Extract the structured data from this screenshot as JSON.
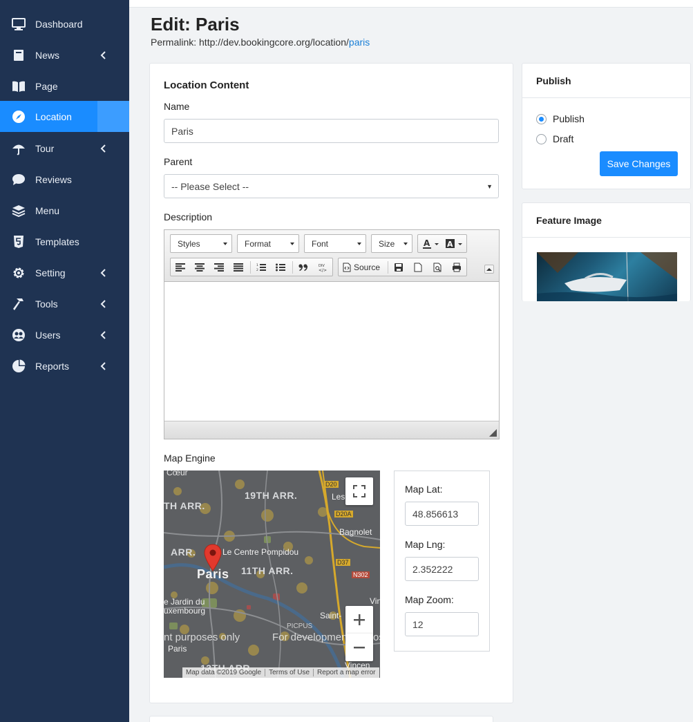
{
  "sidebar": {
    "items": [
      {
        "label": "Dashboard",
        "icon": "monitor-icon",
        "has_children": false,
        "active": false
      },
      {
        "label": "News",
        "icon": "book-icon",
        "has_children": true,
        "active": false
      },
      {
        "label": "Page",
        "icon": "book-open-icon",
        "has_children": false,
        "active": false
      },
      {
        "label": "Location",
        "icon": "compass-icon",
        "has_children": false,
        "active": true
      },
      {
        "label": "Tour",
        "icon": "umbrella-icon",
        "has_children": true,
        "active": false
      },
      {
        "label": "Reviews",
        "icon": "comment-icon",
        "has_children": false,
        "active": false
      },
      {
        "label": "Menu",
        "icon": "layers-icon",
        "has_children": false,
        "active": false
      },
      {
        "label": "Templates",
        "icon": "html5-icon",
        "has_children": false,
        "active": false
      },
      {
        "label": "Setting",
        "icon": "gear-icon",
        "has_children": true,
        "active": false
      },
      {
        "label": "Tools",
        "icon": "hammer-icon",
        "has_children": true,
        "active": false
      },
      {
        "label": "Users",
        "icon": "users-icon",
        "has_children": true,
        "active": false
      },
      {
        "label": "Reports",
        "icon": "pie-chart-icon",
        "has_children": true,
        "active": false
      }
    ]
  },
  "header": {
    "title": "Edit: Paris",
    "permalink_prefix": "Permalink: http://dev.bookingcore.org/location/",
    "permalink_slug": "paris"
  },
  "content": {
    "section_title": "Location Content",
    "name_label": "Name",
    "name_value": "Paris",
    "parent_label": "Parent",
    "parent_value": "-- Please Select --",
    "description_label": "Description",
    "editor": {
      "styles": "Styles",
      "format": "Format",
      "font": "Font",
      "size": "Size",
      "source": "Source"
    },
    "map_engine_label": "Map Engine"
  },
  "map": {
    "labels": {
      "coeur": "Cœur",
      "arr19": "19TH ARR.",
      "arr_th": "TH ARR.",
      "les": "Les",
      "bagnolet": "Bagnolet",
      "arr": "ARR.",
      "pompidou": "Le Centre Pompidou",
      "paris": "Paris",
      "arr11": "11TH ARR.",
      "jardin1": "e Jardin du",
      "jardin2": "uxembourg",
      "saint": "Saint-",
      "picpus": "PICPUS",
      "vin": "Vin",
      "paris_small": "Paris",
      "arr13": "13TH ARR",
      "vincen": "Vincen",
      "d20": "D20",
      "d20a": "D20A",
      "d37": "D37",
      "n302": "N302"
    },
    "watermark_left": "nt purposes only",
    "watermark_right": "For development",
    "watermark_right_tail": "os",
    "footer": [
      "Map data ©2019 Google",
      "Terms of Use",
      "Report a map error"
    ]
  },
  "coords": {
    "lat_label": "Map Lat:",
    "lat_value": "48.856613",
    "lng_label": "Map Lng:",
    "lng_value": "2.352222",
    "zoom_label": "Map Zoom:",
    "zoom_value": "12"
  },
  "publish": {
    "title": "Publish",
    "option_publish": "Publish",
    "option_draft": "Draft",
    "selected": "Publish",
    "save_label": "Save Changes"
  },
  "feature": {
    "title": "Feature Image"
  },
  "colors": {
    "sidebar_bg": "#1f3352",
    "accent": "#1a8cff",
    "link": "#1a7fd6"
  }
}
